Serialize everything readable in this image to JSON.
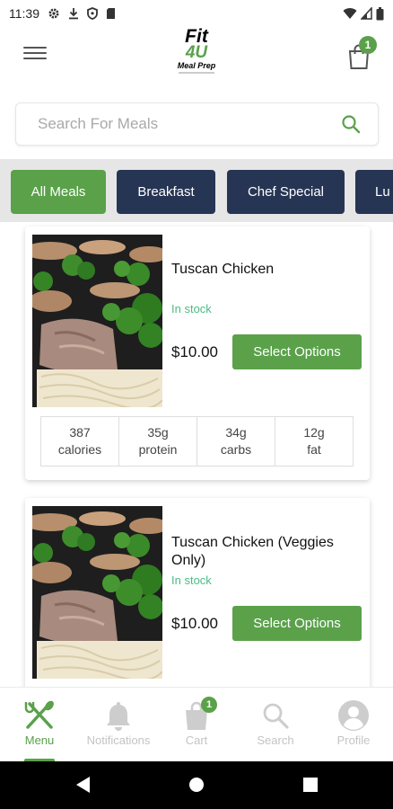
{
  "status_bar": {
    "time": "11:39",
    "icons": [
      "gear-icon",
      "download-icon",
      "shield-icon",
      "sim-card-icon",
      "wifi-icon",
      "signal-icon",
      "battery-icon"
    ]
  },
  "header": {
    "logo_line1": "Fit",
    "logo_line2": "4U",
    "logo_line3": "Meal Prep",
    "cart_count": "1",
    "icons": [
      "hamburger-menu-icon",
      "shopping-bag-icon"
    ]
  },
  "search": {
    "placeholder": "Search For Meals",
    "value": ""
  },
  "categories": [
    {
      "label": "All Meals",
      "active": true
    },
    {
      "label": "Breakfast",
      "active": false
    },
    {
      "label": "Chef Special",
      "active": false
    },
    {
      "label": "Lu",
      "active": false
    }
  ],
  "meals": [
    {
      "name": "Tuscan Chicken",
      "stock": "In stock",
      "price": "$10.00",
      "button": "Select Options",
      "macros": [
        {
          "value": "387",
          "label": "calories"
        },
        {
          "value": "35g",
          "label": "protein"
        },
        {
          "value": "34g",
          "label": "carbs"
        },
        {
          "value": "12g",
          "label": "fat"
        }
      ]
    },
    {
      "name": "Tuscan Chicken (Veggies Only)",
      "stock": "In stock",
      "price": "$10.00",
      "button": "Select Options"
    }
  ],
  "bottom_nav": [
    {
      "label": "Menu",
      "icon": "fork-knife-icon",
      "active": true
    },
    {
      "label": "Notifications",
      "icon": "bell-icon",
      "active": false
    },
    {
      "label": "Cart",
      "icon": "bag-icon",
      "active": false,
      "badge": "1"
    },
    {
      "label": "Search",
      "icon": "search-icon",
      "active": false
    },
    {
      "label": "Profile",
      "icon": "user-icon",
      "active": false
    }
  ],
  "colors": {
    "accent": "#5aa14a",
    "navy": "#263553",
    "stock": "#4dbb85",
    "inactive_nav": "#c4c4c4"
  }
}
